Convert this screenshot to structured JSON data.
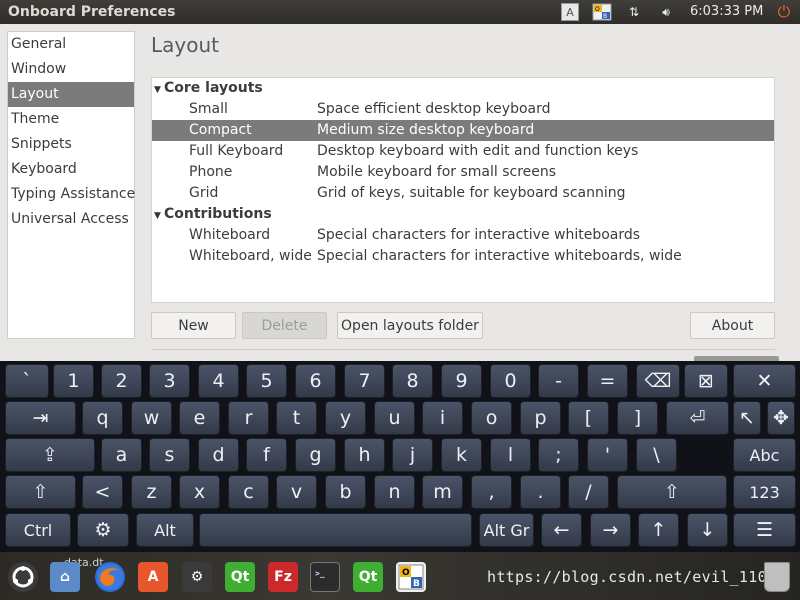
{
  "top_panel": {
    "window_title": "Onboard Preferences",
    "tray_a": "A",
    "clock": "6:03:33 PM"
  },
  "sidebar": {
    "items": [
      {
        "label": "General"
      },
      {
        "label": "Window"
      },
      {
        "label": "Layout",
        "selected": true
      },
      {
        "label": "Theme"
      },
      {
        "label": "Snippets"
      },
      {
        "label": "Keyboard"
      },
      {
        "label": "Typing Assistance"
      },
      {
        "label": "Universal Access"
      }
    ]
  },
  "main": {
    "title": "Layout",
    "groups": [
      {
        "label": "Core layouts",
        "layouts": [
          {
            "name": "Small",
            "description": "Space efficient desktop keyboard"
          },
          {
            "name": "Compact",
            "description": "Medium size desktop keyboard",
            "selected": true
          },
          {
            "name": "Full Keyboard",
            "description": "Desktop keyboard with edit and function keys"
          },
          {
            "name": "Phone",
            "description": "Mobile keyboard for small screens"
          },
          {
            "name": "Grid",
            "description": "Grid of keys, suitable for keyboard scanning"
          }
        ]
      },
      {
        "label": "Contributions",
        "layouts": [
          {
            "name": "Whiteboard",
            "description": "Special characters for interactive whiteboards"
          },
          {
            "name": "Whiteboard, wide",
            "description": "Special characters for interactive whiteboards, wide"
          }
        ]
      }
    ],
    "buttons": {
      "new": "New",
      "delete": "Delete",
      "open_folder": "Open layouts folder",
      "about": "About"
    }
  },
  "keyboard": {
    "rows": [
      [
        "`",
        "1",
        "2",
        "3",
        "4",
        "5",
        "6",
        "7",
        "8",
        "9",
        "0",
        "-",
        "=",
        "⌫",
        "⊠",
        "✕"
      ],
      [
        "⇥",
        "q",
        "w",
        "e",
        "r",
        "t",
        "y",
        "u",
        "i",
        "o",
        "p",
        "[",
        "]",
        "⏎",
        "↖",
        "✥"
      ],
      [
        "⇪",
        "a",
        "s",
        "d",
        "f",
        "g",
        "h",
        "j",
        "k",
        "l",
        ";",
        "'",
        "\\",
        "Abc"
      ],
      [
        "⇧",
        "<",
        "z",
        "x",
        "c",
        "v",
        "b",
        "n",
        "m",
        ",",
        ".",
        "/",
        "⇧",
        "123"
      ],
      [
        "Ctrl",
        "⚙",
        "Alt",
        " ",
        "Alt Gr",
        "←",
        "→",
        "↑",
        "↓",
        "☰"
      ]
    ]
  },
  "dock": {
    "desktop_label": "data.dt",
    "watermark": "https://blog.csdn.net/evil_110"
  },
  "colors": {
    "selection": "#7b7b7b",
    "panel": "#3f3e3a",
    "key_top": "#4b5468",
    "key_bottom": "#333a49",
    "keyboard_bg": "#101218",
    "power": "#e8632a"
  }
}
